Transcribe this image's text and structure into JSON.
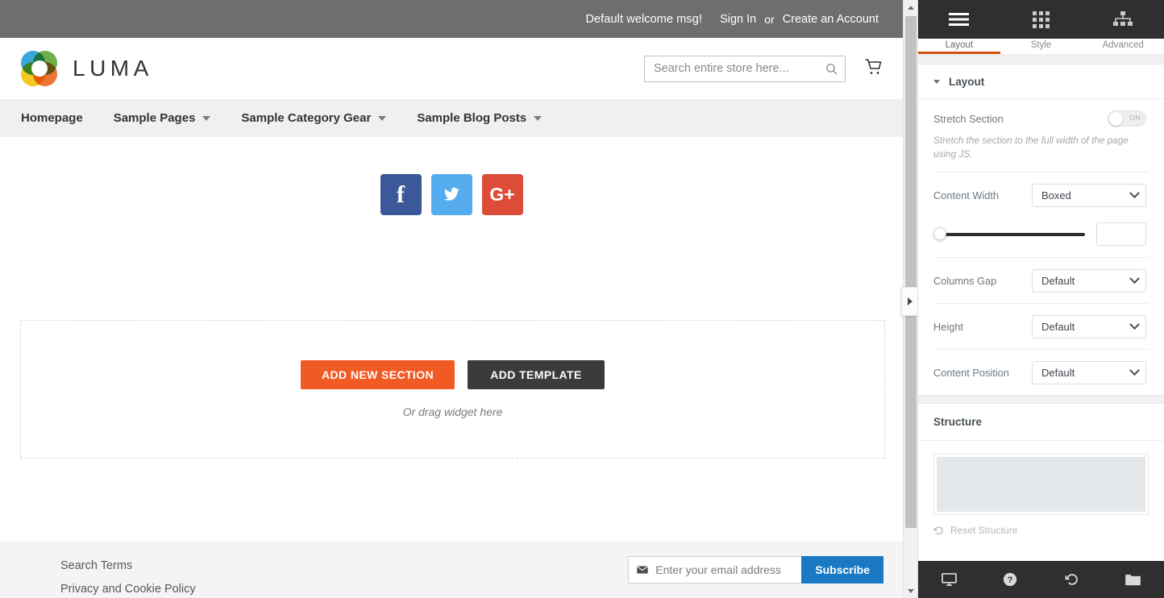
{
  "preview": {
    "topbar": {
      "welcome": "Default welcome msg!",
      "sign_in": "Sign In",
      "or": "or",
      "create_account": "Create an Account"
    },
    "header": {
      "logo_text": "LUMA",
      "search_placeholder": "Search entire store here...",
      "search_value": "",
      "search_icon": "search-icon",
      "cart_icon": "cart-icon"
    },
    "nav": [
      {
        "label": "Homepage",
        "has_caret": false
      },
      {
        "label": "Sample Pages",
        "has_caret": true
      },
      {
        "label": "Sample Category Gear",
        "has_caret": true
      },
      {
        "label": "Sample Blog Posts",
        "has_caret": true
      }
    ],
    "social": [
      {
        "name": "facebook",
        "glyph": "f",
        "color": "#3b5998"
      },
      {
        "name": "twitter",
        "glyph": "🐦",
        "color": "#55acee"
      },
      {
        "name": "google-plus",
        "glyph": "G+",
        "color": "#dd4b39"
      }
    ],
    "dropzone": {
      "add_section": "ADD NEW SECTION",
      "add_template": "ADD TEMPLATE",
      "hint": "Or drag widget here",
      "add_section_color": "#f15a22",
      "add_template_color": "#3b3b3b"
    },
    "footer": {
      "links": [
        "Search Terms",
        "Privacy and Cookie Policy"
      ],
      "newsletter_placeholder": "Enter your email address",
      "newsletter_value": "",
      "subscribe_label": "Subscribe",
      "subscribe_color": "#1979c3",
      "envelope_icon": "envelope-icon"
    }
  },
  "editor": {
    "tabs": [
      {
        "label": "Layout",
        "icon": "hamburger-icon",
        "active": true
      },
      {
        "label": "Style",
        "icon": "grid-icon",
        "active": false
      },
      {
        "label": "Advanced",
        "icon": "sitemap-icon",
        "active": false
      }
    ],
    "accent_color": "#d4500e",
    "layout_section": {
      "title": "Layout",
      "stretch_section": {
        "label": "Stretch Section",
        "value": "NO",
        "description": "Stretch the section to the full width of the page using JS."
      },
      "content_width": {
        "label": "Content Width",
        "value": "Boxed"
      },
      "content_width_slider": {
        "value": "",
        "placeholder": ""
      },
      "columns_gap": {
        "label": "Columns Gap",
        "value": "Default"
      },
      "height": {
        "label": "Height",
        "value": "Default"
      },
      "content_position": {
        "label": "Content Position",
        "value": "Default"
      }
    },
    "structure_section": {
      "title": "Structure",
      "reset_label": "Reset Structure",
      "reset_icon": "undo-icon"
    },
    "bottom_bar": [
      {
        "name": "responsive-mode-icon"
      },
      {
        "name": "help-icon"
      },
      {
        "name": "history-icon"
      },
      {
        "name": "library-icon"
      }
    ]
  }
}
